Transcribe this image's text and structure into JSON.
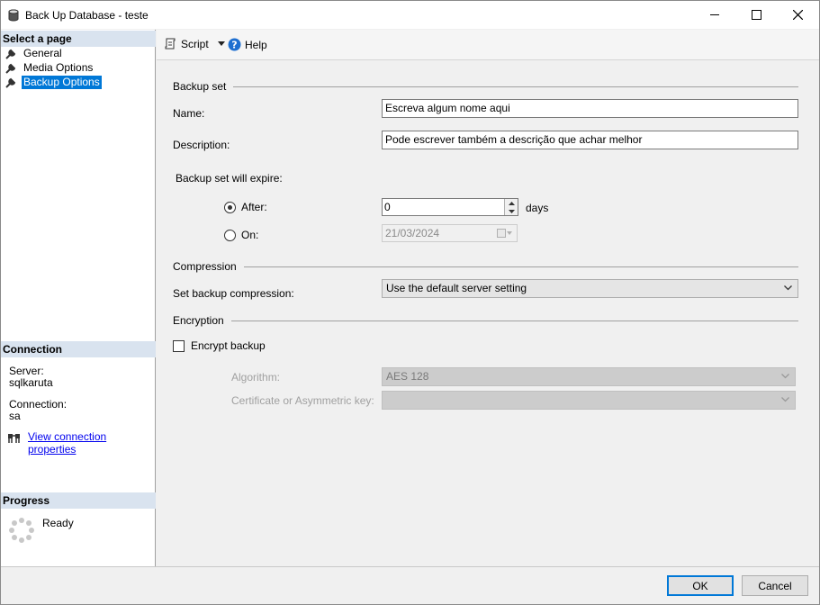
{
  "window": {
    "title": "Back Up Database - teste"
  },
  "left": {
    "select_page_heading": "Select a page",
    "pages": [
      {
        "label": "General"
      },
      {
        "label": "Media Options"
      },
      {
        "label": "Backup Options"
      }
    ],
    "connection_heading": "Connection",
    "server_label": "Server:",
    "server_value": "sqlkaruta",
    "connection_label": "Connection:",
    "connection_value": "sa",
    "view_connection_link": "View connection properties",
    "progress_heading": "Progress",
    "progress_status": "Ready"
  },
  "toolbar": {
    "script_label": "Script",
    "help_label": "Help"
  },
  "backup_set": {
    "group_label": "Backup set",
    "name_label": "Name:",
    "name_value": "Escreva algum nome aqui",
    "description_label": "Description:",
    "description_value": "Pode escrever também a descrição que achar melhor",
    "expire_label": "Backup set will expire:",
    "after_label": "After:",
    "after_value": "0",
    "days_label": "days",
    "on_label": "On:",
    "on_date": "21/03/2024"
  },
  "compression": {
    "group_label": "Compression",
    "set_label": "Set backup compression:",
    "selected": "Use the default server setting"
  },
  "encryption": {
    "group_label": "Encryption",
    "encrypt_label": "Encrypt backup",
    "algorithm_label": "Algorithm:",
    "algorithm_value": "AES 128",
    "certificate_label": "Certificate or Asymmetric key:",
    "certificate_value": ""
  },
  "footer": {
    "ok_label": "OK",
    "cancel_label": "Cancel"
  },
  "colors": {
    "selection": "#0078d7",
    "section_header": "#d9e3ef",
    "link": "#0000ee"
  }
}
